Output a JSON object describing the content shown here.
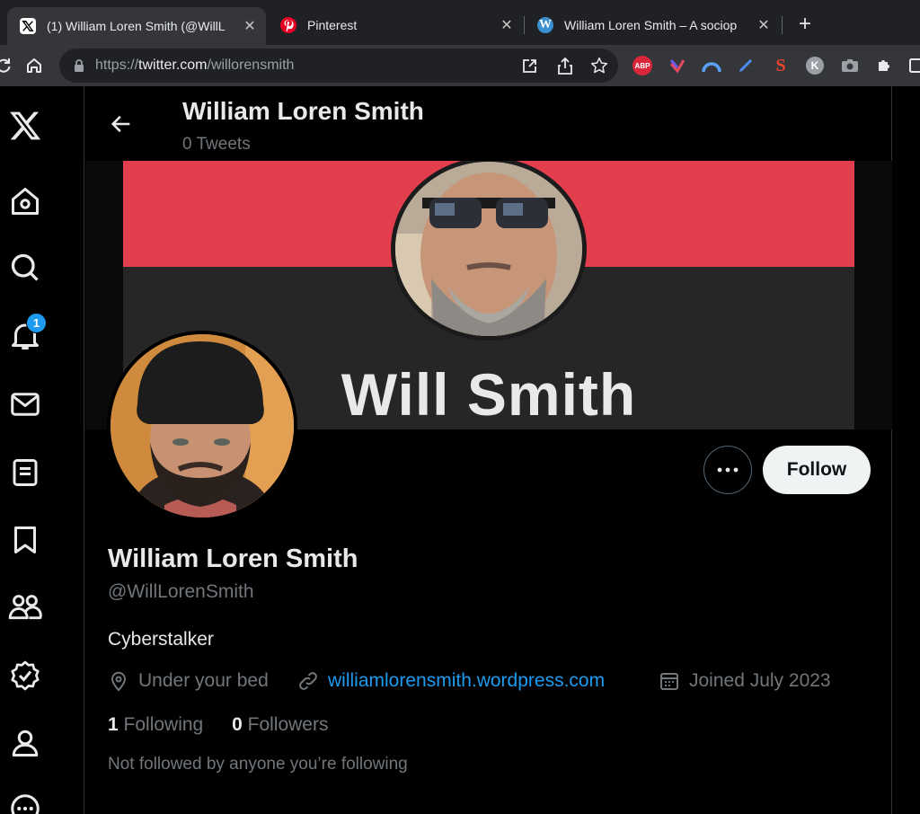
{
  "browser": {
    "tabs": [
      {
        "title": "(1) William Loren Smith (@WillL",
        "icon": "x-logo-icon",
        "active": true
      },
      {
        "title": "Pinterest",
        "icon": "pinterest-icon",
        "active": false
      },
      {
        "title": "William Loren Smith – A sociop",
        "icon": "wordpress-icon",
        "active": false
      }
    ],
    "new_tab_label": "+",
    "url_scheme": "https://",
    "url_host": "twitter.com",
    "url_path": "/willorensmith",
    "extensions": [
      "adblock-plus-icon",
      "extension-bookmark-icon",
      "extension-arc-icon",
      "extension-pen-icon",
      "seo-extension-icon",
      "profile-k-icon",
      "camera-icon",
      "puzzle-icon",
      "sidebar-icon"
    ],
    "abp_label": "ABP",
    "profile_initial": "K"
  },
  "nav": {
    "items": [
      "x-logo-icon",
      "home-icon",
      "search-icon",
      "notifications-icon",
      "messages-icon",
      "lists-icon",
      "bookmarks-icon",
      "communities-icon",
      "verified-icon",
      "profile-icon",
      "more-icon"
    ],
    "notification_count": "1"
  },
  "header": {
    "name": "William Loren Smith",
    "tweet_count": "0 Tweets"
  },
  "banner": {
    "text": "Will Smith",
    "accent_color": "#e33e4e"
  },
  "profile": {
    "name": "William Loren Smith",
    "handle": "@WillLorenSmith",
    "bio": "Cyberstalker",
    "location": "Under your bed",
    "website": "williamlorensmith.wordpress.com",
    "joined": "Joined July 2023",
    "following_count": "1",
    "following_label": "Following",
    "followers_count": "0",
    "followers_label": "Followers",
    "mutuals_text": "Not followed by anyone you’re following",
    "follow_label": "Follow",
    "link_color": "#1d9bf0"
  }
}
